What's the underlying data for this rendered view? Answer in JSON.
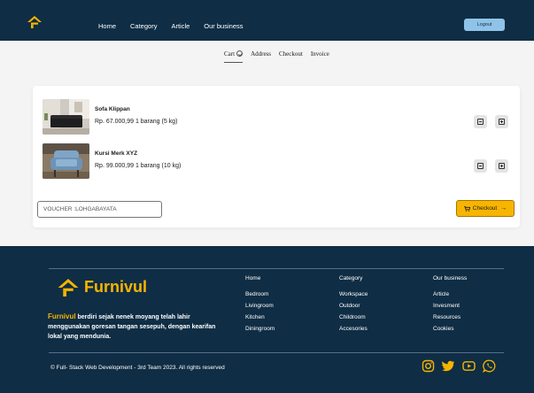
{
  "header": {
    "nav": [
      "Home",
      "Category",
      "Article",
      "Our business"
    ],
    "logout_label": "Logout"
  },
  "steps": [
    "Cart",
    "Address",
    "Checkout",
    "Invoice"
  ],
  "cart": {
    "items": [
      {
        "name": "Sofa Klippan",
        "price": "Rp. 67.000,99",
        "qty": "1 barang (5 kg)"
      },
      {
        "name": "Kursi Merk XYZ",
        "price": "Rp. 99.000,99",
        "qty": "1 barang (10 kg)"
      }
    ],
    "voucher_placeholder": "VOUCHER :LOHGABAYATA",
    "checkout_label": "Checkout"
  },
  "footer": {
    "brand": "Furnivul",
    "tagline_highlight": "Furnivul",
    "tagline_rest": " berdiri sejak nenek moyang telah lahir menggunakan goresan tangan sesepuh, dengan kearifan lokal yang mendunia.",
    "columns": [
      {
        "head": "Home",
        "items": [
          "Bedroom",
          "Livingroom",
          "Kitchen",
          "Diningroom"
        ]
      },
      {
        "head": "Category",
        "items": [
          "Workspace",
          "Outdoor",
          "Childroom",
          "Accesories"
        ]
      },
      {
        "head": "Our business",
        "items": [
          "Article",
          "Invesment",
          "Resources",
          "Cookies"
        ]
      }
    ],
    "copyright": "© Full- Stack Web Development - 3rd Team 2023. All rights reserved",
    "socials": [
      "instagram-icon",
      "twitter-icon",
      "youtube-icon",
      "whatsapp-icon"
    ]
  },
  "colors": {
    "navy": "#0f2d44",
    "accent": "#f7b500",
    "logout_bg": "#8fc3e8"
  }
}
